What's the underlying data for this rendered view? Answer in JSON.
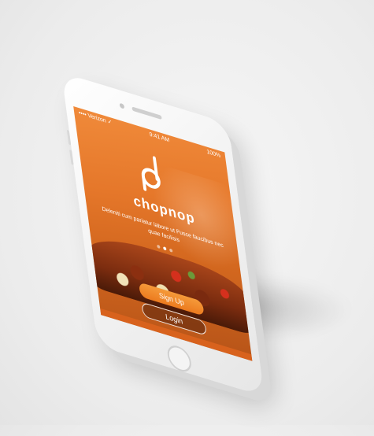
{
  "status_bar": {
    "left": "•••• Verizon ✓",
    "time": "9:41 AM",
    "right": "100%"
  },
  "app": {
    "name": "chopnop",
    "tagline": "Deleniti cum pariatur labore ut Fusce faucibus nec quae facilisis",
    "signup_label": "Sign Up",
    "login_label": "Login"
  },
  "colors": {
    "brand_orange": "#ec7b1f",
    "background": "#ececec"
  },
  "pager": {
    "count": 3,
    "active_index": 1
  }
}
